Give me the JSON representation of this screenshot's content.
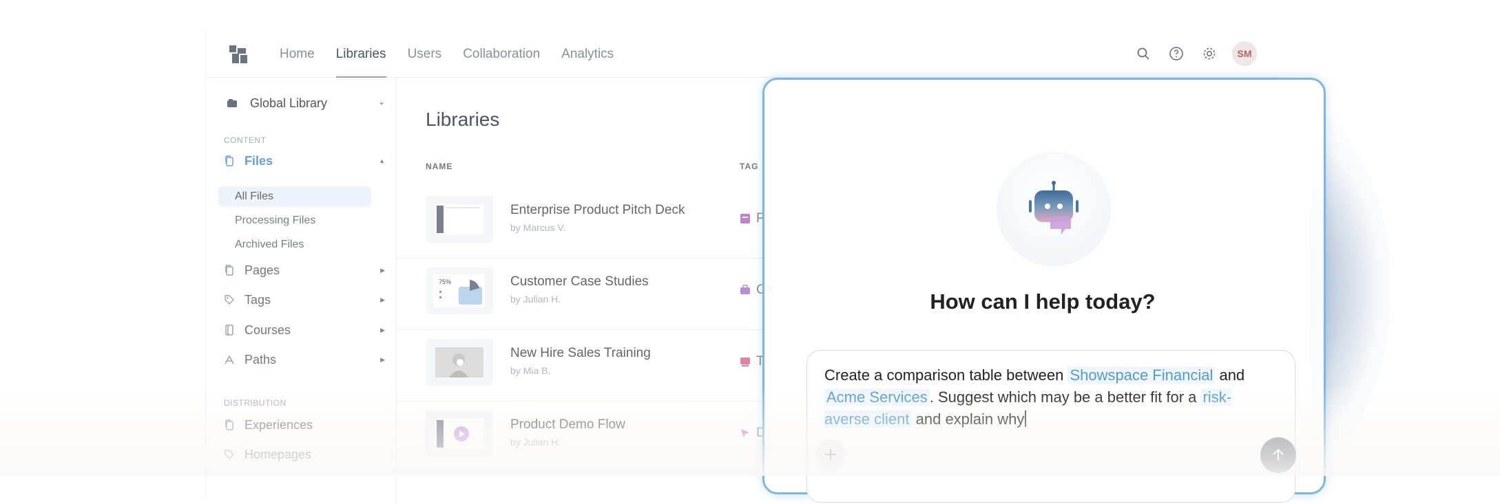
{
  "nav": {
    "tabs": [
      {
        "label": "Home"
      },
      {
        "label": "Libraries"
      },
      {
        "label": "Users"
      },
      {
        "label": "Collaboration"
      },
      {
        "label": "Analytics"
      }
    ],
    "active_tab": "Libraries",
    "icons": [
      "search-icon",
      "help-icon",
      "gear-icon"
    ],
    "avatar_initials": "SM"
  },
  "sidebar": {
    "library_selector": "Global Library",
    "content_label": "CONTENT",
    "files_label": "Files",
    "file_subitems": [
      "All Files",
      "Processing Files",
      "Archived Files"
    ],
    "items": [
      {
        "label": "Pages"
      },
      {
        "label": "Tags"
      },
      {
        "label": "Courses"
      },
      {
        "label": "Paths"
      }
    ],
    "distribution_label": "DISTRIBUTION",
    "distribution_items": [
      {
        "label": "Experiences"
      },
      {
        "label": "Homepages"
      }
    ]
  },
  "main": {
    "title": "Libraries",
    "columns": {
      "name": "NAME",
      "tag": "TAG"
    },
    "rows": [
      {
        "title": "Enterprise Product Pitch Deck",
        "author": "by Marcus V.",
        "tag": "Pi"
      },
      {
        "title": "Customer Case Studies",
        "author": "by Julian H.",
        "tag": "Ca",
        "thumb_label": "75%"
      },
      {
        "title": "New Hire Sales Training",
        "author": "by Mia B.",
        "tag": "Tr"
      },
      {
        "title": "Product Demo Flow",
        "author": "by Julian H.",
        "tag": "De"
      }
    ]
  },
  "assistant": {
    "heading": "How can I help today?",
    "prompt_parts": [
      {
        "text": "Create a comparison table between ",
        "highlight": false
      },
      {
        "text": "Showspace Financial",
        "highlight": true
      },
      {
        "text": " and ",
        "highlight": false
      },
      {
        "text": "Acme Services",
        "highlight": true
      },
      {
        "text": ". Suggest which may be a better fit for a ",
        "highlight": false
      },
      {
        "text": "risk-averse client",
        "highlight": true
      },
      {
        "text": " and explain why",
        "highlight": false
      }
    ],
    "accent_color": "#7fb6df"
  }
}
